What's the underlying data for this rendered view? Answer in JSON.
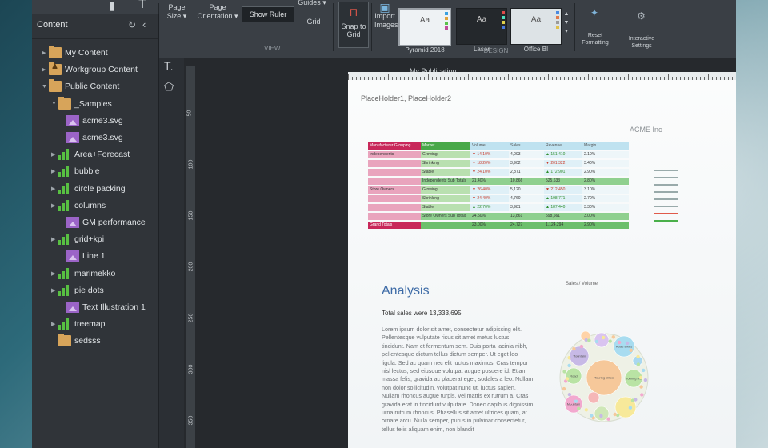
{
  "ribbon": {
    "page_size_label": "Page Size ▾",
    "page_orientation_label": "Page Orientation ▾",
    "show_ruler_label": "Show Ruler",
    "guides_label": "Guides ▾",
    "grid_label": "Grid",
    "view_group_label": "VIEW",
    "snap_label": "Snap to Grid",
    "import_images_label": "Import Images",
    "design_group_label": "DESIGN",
    "themes": [
      {
        "name": "Pyramid 2018",
        "sample": "Aa"
      },
      {
        "name": "Laser",
        "sample": "Aa"
      },
      {
        "name": "Office BI",
        "sample": "Aa"
      }
    ],
    "reset_formatting_label": "Reset Formatting",
    "interactive_settings_label": "Interactive Settings"
  },
  "panel": {
    "title": "Content",
    "items": [
      {
        "label": "My Content",
        "icon": "folder-icon",
        "arrow": "▶"
      },
      {
        "label": "Workgroup Content",
        "icon": "shared-folder-icon",
        "arrow": "▶"
      },
      {
        "label": "Public Content",
        "icon": "folder-icon",
        "arrow": "▼"
      },
      {
        "label": "_Samples",
        "icon": "folder-icon",
        "arrow": "▼"
      },
      {
        "label": "acme3.svg",
        "icon": "image-icon",
        "arrow": ""
      },
      {
        "label": "acme3.svg",
        "icon": "image-icon",
        "arrow": ""
      },
      {
        "label": "Area+Forecast",
        "icon": "bar-chart-icon",
        "arrow": "▶"
      },
      {
        "label": "bubble",
        "icon": "bar-chart-icon",
        "arrow": "▶"
      },
      {
        "label": "circle packing",
        "icon": "bar-chart-icon",
        "arrow": "▶"
      },
      {
        "label": "columns",
        "icon": "bar-chart-icon",
        "arrow": "▶"
      },
      {
        "label": "GM performance",
        "icon": "image-icon",
        "arrow": ""
      },
      {
        "label": "grid+kpi",
        "icon": "bar-chart-icon",
        "arrow": "▶"
      },
      {
        "label": "Line 1",
        "icon": "image-icon",
        "arrow": ""
      },
      {
        "label": "marimekko",
        "icon": "bar-chart-icon",
        "arrow": "▶"
      },
      {
        "label": "pie dots",
        "icon": "bar-chart-icon",
        "arrow": "▶"
      },
      {
        "label": "Text Illustration 1",
        "icon": "image-icon",
        "arrow": ""
      },
      {
        "label": "treemap",
        "icon": "bar-chart-icon",
        "arrow": "▶"
      },
      {
        "label": "sedsss",
        "icon": "folder-icon",
        "arrow": ""
      }
    ]
  },
  "canvas": {
    "publication_title": "My Publication",
    "ruler_numbers": [
      "50",
      "100",
      "150",
      "200",
      "250",
      "300",
      "350"
    ]
  },
  "page": {
    "placeholders": "PlaceHolder1, PlaceHolder2",
    "brand": "ACME Inc",
    "analysis_title": "Analysis",
    "total_sales": "Total sales were 13,333,695",
    "lorem": "Lorem ipsum dolor sit amet, consectetur adipiscing elit. Pellentesque vulputate risus sit amet metus luctus tincidunt. Nam et fermentum sem. Duis porta lacinia nibh, pellentesque dictum tellus dictum semper. Ut eget leo ligula. Sed ac quam nec elit luctus maximus. Cras tempor nisl lectus, sed eiusque volutpat augue posuere id. Etiam massa felis, gravida ac placerat eget, sodales a leo. Nullam non dolor sollicitudin, volutpat nunc ut, luctus sapien. Nullam rhoncus augue turpis, vel mattis ex rutrum a. Cras gravida erat in tincidunt vulputate. Donec dapibus dignissim urna rutrum rhoncus. Phasellus sit amet ultrices quam, at ornare arcu. Nulla semper, purus in pulvinar consectetur, tellus felis aliquam enim, non blandit",
    "bubble_title": "Sales / Volume",
    "table": {
      "header": [
        "Manufacturer Grouping",
        "Market",
        "Volume",
        "Sales",
        "Revenue",
        "Margin"
      ],
      "rows": [
        {
          "group": "Independents",
          "market": "Growing",
          "v": "▼ 14.10%",
          "s": "4,093",
          "r": "▲ 151,410",
          "m": "2.10%",
          "shade": "A"
        },
        {
          "group": "",
          "market": "Shrinking",
          "v": "▼ 18.20%",
          "s": "3,902",
          "r": "▼ 201,322",
          "m": "3.40%",
          "shade": "A"
        },
        {
          "group": "",
          "market": "Stable",
          "v": "▼ 24.10%",
          "s": "2,871",
          "r": "▲ 172,901",
          "m": "2.90%",
          "shade": "A"
        },
        {
          "group": "",
          "market": "Independents Sub Totals",
          "v": "21.40%",
          "s": "10,866",
          "r": "525,633",
          "m": "2.80%",
          "shade": "S"
        },
        {
          "group": "Store Owners",
          "market": "Growing",
          "v": "▼ 26.40%",
          "s": "5,120",
          "r": "▼ 212,450",
          "m": "3.10%",
          "shade": "A"
        },
        {
          "group": "",
          "market": "Shrinking",
          "v": "▼ 24.40%",
          "s": "4,760",
          "r": "▲ 198,771",
          "m": "2.70%",
          "shade": "A"
        },
        {
          "group": "",
          "market": "Stable",
          "v": "▲ 22.70%",
          "s": "3,981",
          "r": "▲ 187,440",
          "m": "3.30%",
          "shade": "A"
        },
        {
          "group": "",
          "market": "Store Owners Sub Totals",
          "v": "24.50%",
          "s": "13,861",
          "r": "598,661",
          "m": "3.00%",
          "shade": "S"
        },
        {
          "group": "Grand Totals",
          "market": "",
          "v": "23.00%",
          "s": "24,727",
          "r": "1,124,294",
          "m": "2.90%",
          "shade": "G"
        }
      ]
    },
    "bubbles": [
      {
        "label": "Touring Bikes",
        "color": "#f6c89a"
      },
      {
        "label": "Road Bikes",
        "color": "#a8dcf0"
      },
      {
        "label": "Mountain",
        "color": "#c7b9e6"
      },
      {
        "label": "Road",
        "color": "#b9e3a4"
      },
      {
        "label": "Touring Ra",
        "color": "#b9e3a4"
      },
      {
        "label": "Mountain",
        "color": "#f2a9cf"
      },
      {
        "label": "",
        "color": "#f7e99a"
      },
      {
        "label": "",
        "color": "#d9c4f0"
      },
      {
        "label": "",
        "color": "#cfe7b7"
      },
      {
        "label": "",
        "color": "#ffd3a8"
      },
      {
        "label": "",
        "color": "#a9d8ef"
      },
      {
        "label": "",
        "color": "#f5b7b7"
      }
    ]
  }
}
